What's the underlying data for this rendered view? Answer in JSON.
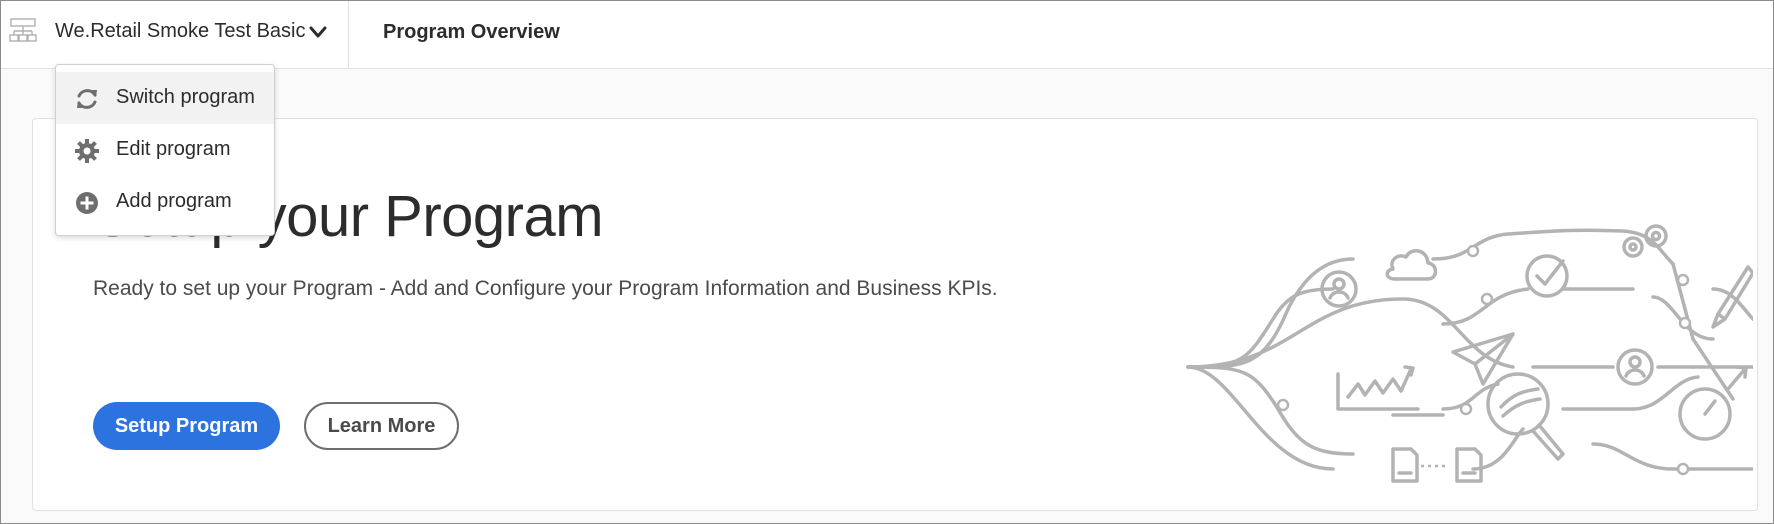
{
  "header": {
    "program_name": "We.Retail Smoke Test Basic",
    "page_title": "Program Overview"
  },
  "program_menu": {
    "items": [
      {
        "label": "Switch program",
        "icon": "refresh-icon"
      },
      {
        "label": "Edit program",
        "icon": "gear-icon"
      },
      {
        "label": "Add program",
        "icon": "add-circle-icon"
      }
    ]
  },
  "hero": {
    "title": "Setup your Program",
    "description": "Ready to set up your Program - Add and Configure your Program Information and Business KPIs.",
    "primary_button": "Setup Program",
    "secondary_button": "Learn More"
  },
  "colors": {
    "accent": "#2d73e0",
    "illustration_stroke": "#b3b3b3"
  }
}
